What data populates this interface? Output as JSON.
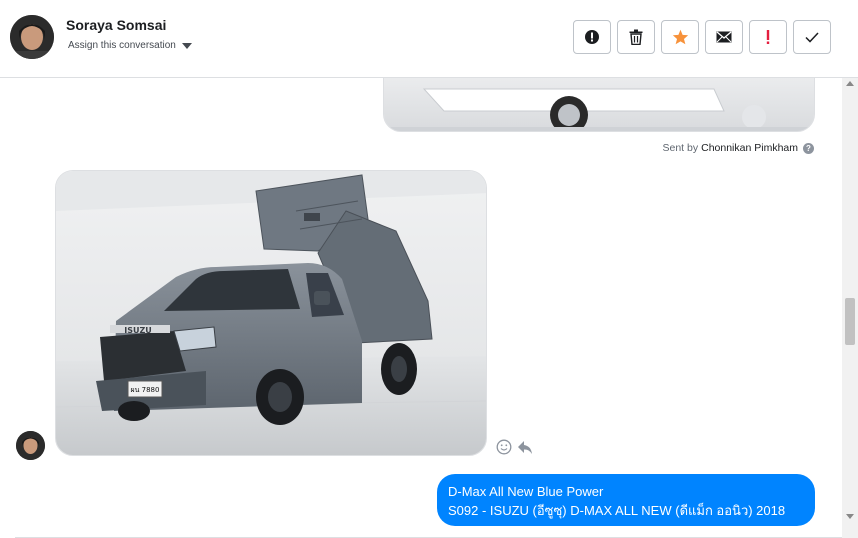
{
  "header": {
    "contact_name": "Soraya Somsai",
    "assign_label": "Assign this conversation",
    "actions": [
      {
        "name": "mark-spam-button",
        "icon": "alert-circle-icon"
      },
      {
        "name": "delete-button",
        "icon": "trash-icon"
      },
      {
        "name": "star-button",
        "icon": "star-icon",
        "color": "#f7923b"
      },
      {
        "name": "mark-unread-button",
        "icon": "envelope-icon"
      },
      {
        "name": "follow-up-button",
        "icon": "exclamation-icon",
        "color": "#e41e3f"
      },
      {
        "name": "mark-done-button",
        "icon": "check-icon"
      }
    ]
  },
  "conversation": {
    "sent_by_prefix": "Sent by",
    "sent_by_name": "Chonnikan Pimkham",
    "outgoing_message": {
      "line1": "D-Max All New Blue Power",
      "line2": "S092 - ISUZU (อีซูซุ) D-MAX ALL NEW (ดีแม็ก ออนิว) 2018"
    },
    "plate_text": "ผน 7880"
  },
  "colors": {
    "outgoing_bubble": "#0084ff",
    "star": "#f7923b",
    "alert": "#e41e3f"
  }
}
